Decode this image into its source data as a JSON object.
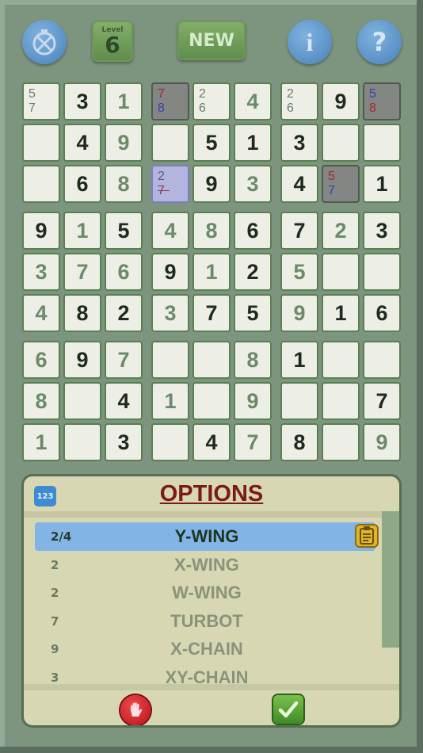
{
  "topbar": {
    "timer_icon": "stopwatch-icon",
    "level_label": "Level",
    "level_value": "6",
    "new_label": "NEW",
    "info_label": "i",
    "help_label": "?"
  },
  "colors": {
    "background": "#7d947f",
    "cell": "#edeee6",
    "given": "#1d2a1d",
    "placed": "#6a8a6a",
    "selected_row": "#83b4e6",
    "title": "#7b1b16"
  },
  "grid": [
    [
      {
        "c": "5 7"
      },
      {
        "g": "3"
      },
      {
        "p": "1"
      },
      {
        "c2": [
          "7",
          "8"
        ],
        "dark": true
      },
      {
        "c": "2 6"
      },
      {
        "p": "4"
      },
      {
        "c": "2 6"
      },
      {
        "g": "9"
      },
      {
        "c2": [
          "5",
          "8"
        ],
        "dark": true,
        "order": "blue-red"
      }
    ],
    [
      {},
      {
        "g": "4"
      },
      {
        "p": "9"
      },
      {},
      {
        "g": "5"
      },
      {
        "g": "1"
      },
      {
        "g": "3"
      },
      {},
      {}
    ],
    [
      {},
      {
        "g": "6"
      },
      {
        "p": "8"
      },
      {
        "c3": [
          "2",
          "7"
        ],
        "light": true
      },
      {
        "g": "9"
      },
      {
        "p": "3"
      },
      {
        "g": "4"
      },
      {
        "c2": [
          "5",
          "7"
        ],
        "dark": true
      },
      {
        "g": "1"
      }
    ],
    [
      {
        "g": "9"
      },
      {
        "p": "1"
      },
      {
        "g": "5"
      },
      {
        "p": "4"
      },
      {
        "p": "8"
      },
      {
        "g": "6"
      },
      {
        "g": "7"
      },
      {
        "p": "2"
      },
      {
        "g": "3"
      }
    ],
    [
      {
        "p": "3"
      },
      {
        "p": "7"
      },
      {
        "p": "6"
      },
      {
        "g": "9"
      },
      {
        "p": "1"
      },
      {
        "g": "2"
      },
      {
        "p": "5"
      },
      {},
      {}
    ],
    [
      {
        "p": "4"
      },
      {
        "g": "8"
      },
      {
        "g": "2"
      },
      {
        "p": "3"
      },
      {
        "g": "7"
      },
      {
        "g": "5"
      },
      {
        "p": "9"
      },
      {
        "g": "1"
      },
      {
        "g": "6"
      }
    ],
    [
      {
        "p": "6"
      },
      {
        "g": "9"
      },
      {
        "p": "7"
      },
      {},
      {},
      {
        "p": "8"
      },
      {
        "g": "1"
      },
      {},
      {}
    ],
    [
      {
        "p": "8"
      },
      {},
      {
        "g": "4"
      },
      {
        "p": "1"
      },
      {},
      {
        "p": "9"
      },
      {},
      {},
      {
        "g": "7"
      }
    ],
    [
      {
        "p": "1"
      },
      {},
      {
        "g": "3"
      },
      {},
      {
        "g": "4"
      },
      {
        "p": "7"
      },
      {
        "g": "8"
      },
      {},
      {
        "p": "9"
      }
    ]
  ],
  "options": {
    "icon_label": "123",
    "title": "OPTIONS",
    "items": [
      {
        "count": "2/4",
        "name": "Y-WING",
        "selected": true
      },
      {
        "count": "2",
        "name": "X-WING"
      },
      {
        "count": "2",
        "name": "W-WING"
      },
      {
        "count": "7",
        "name": "TURBOT"
      },
      {
        "count": "9",
        "name": "X-CHAIN"
      },
      {
        "count": "3",
        "name": "XY-CHAIN"
      }
    ],
    "cancel_icon": "stop-hand-icon",
    "confirm_icon": "checkmark-icon"
  }
}
